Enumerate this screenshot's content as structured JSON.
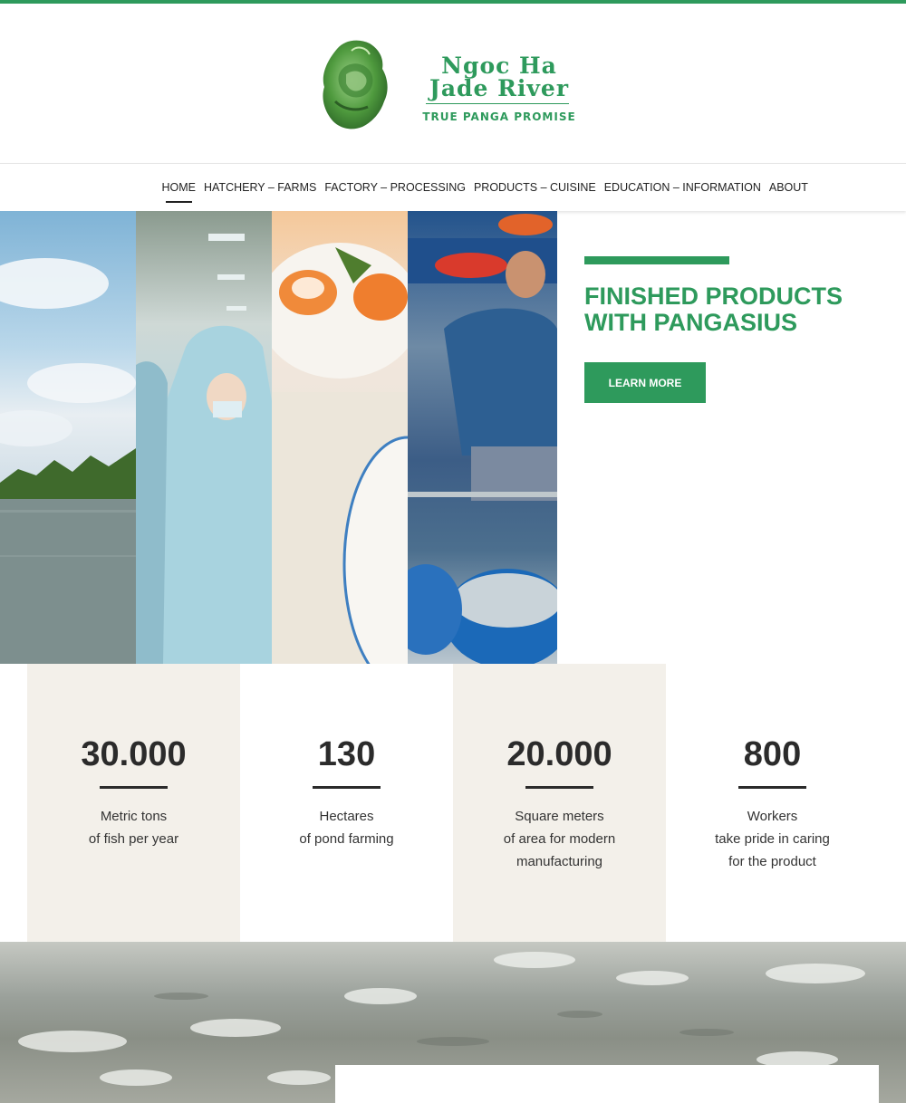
{
  "brand": {
    "name_line1": "Ngoc Ha",
    "name_line2": "Jade River",
    "tagline": "TRUE PANGA PROMISE",
    "logo_icon": "jade-dragon-logo",
    "accent_color": "#2e9a5c"
  },
  "nav": {
    "items": [
      {
        "label": "HOME",
        "active": true
      },
      {
        "label": "HATCHERY – FARMS"
      },
      {
        "label": "FACTORY – PROCESSING"
      },
      {
        "label": "PRODUCTS – CUISINE"
      },
      {
        "label": "EDUCATION – INFORMATION"
      },
      {
        "label": "ABOUT"
      }
    ]
  },
  "hero": {
    "title_line1": "FINISHED PRODUCTS",
    "title_line2": "WITH PANGASIUS",
    "button_label": "LEARN MORE"
  },
  "stats": [
    {
      "value": "30.000",
      "lines": [
        "Metric tons",
        "of fish per year"
      ]
    },
    {
      "value": "130",
      "lines": [
        "Hectares",
        "of pond farming"
      ]
    },
    {
      "value": "20.000",
      "lines": [
        "Square meters",
        "of area for modern",
        "manufacturing"
      ]
    },
    {
      "value": "800",
      "lines": [
        "Workers",
        "take pride in caring",
        "for the product"
      ]
    }
  ]
}
